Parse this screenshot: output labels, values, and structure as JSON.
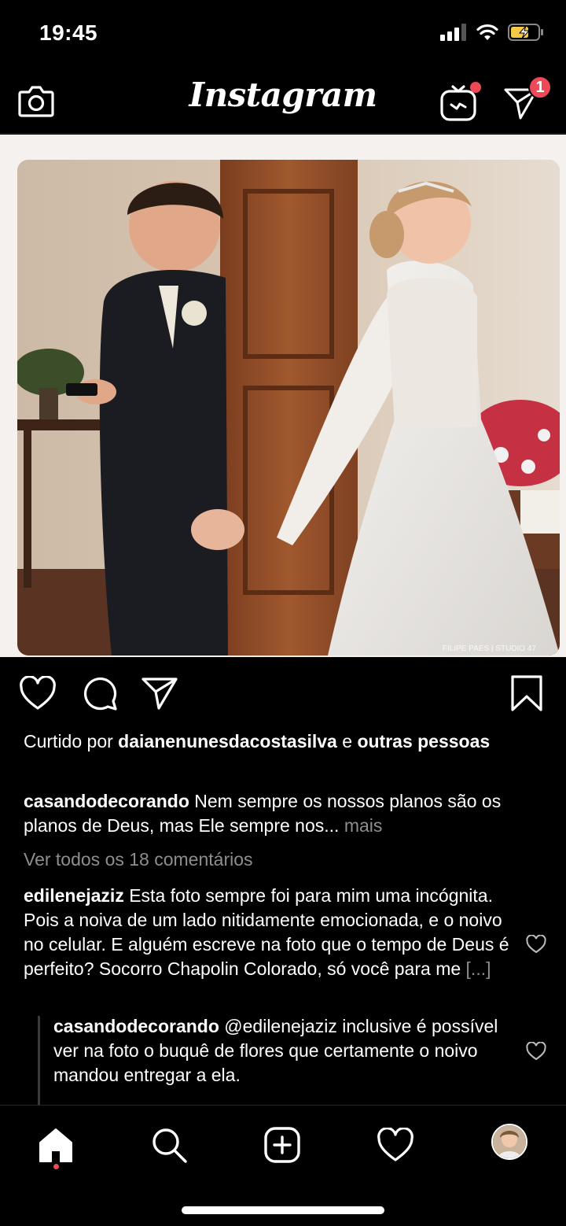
{
  "status_bar": {
    "time": "19:45",
    "icons": [
      "signal-icon",
      "wifi-icon",
      "battery-charging-icon"
    ]
  },
  "header": {
    "logo": "Instagram",
    "camera_icon": "camera-icon",
    "igtv_icon": "igtv-icon",
    "direct_icon": "direct-message-icon",
    "direct_badge": "1"
  },
  "post": {
    "image_credit": "FILIPE PAES | STUDIO 47",
    "actions": [
      "heart-icon",
      "comment-icon",
      "share-icon",
      "bookmark-icon"
    ],
    "likes": {
      "prefix": "Curtido por",
      "user": "daianenunesdacostasilva",
      "connector": "e",
      "others": "outras pessoas"
    },
    "caption": {
      "user": "casandodecorando",
      "text": "Nem sempre os nossos planos são os planos de Deus, mas Ele sempre nos...",
      "more": "mais"
    },
    "view_all_comments": "Ver todos os 18 comentários",
    "comments": [
      {
        "user": "edilenejaziz",
        "text": "Esta foto sempre foi para mim uma incógnita. Pois a noiva de um lado nitidamente emocionada,  e o noivo no celular.  E alguém escreve na foto que o tempo de Deus é perfeito? Socorro Chapolin Colorado,  só você para me",
        "truncation": "[...]"
      }
    ],
    "reply": {
      "user": "casandodecorando",
      "text": "@edilenejaziz inclusive é possível ver na foto o buquê de flores que certamente o noivo mandou entregar a ela."
    }
  },
  "tab_bar": {
    "items": [
      "home-icon",
      "search-icon",
      "new-post-icon",
      "activity-heart-icon",
      "profile-avatar"
    ]
  },
  "colors": {
    "background": "#000000",
    "text": "#ffffff",
    "muted": "#8e8e8e",
    "badge": "#ed4956"
  }
}
